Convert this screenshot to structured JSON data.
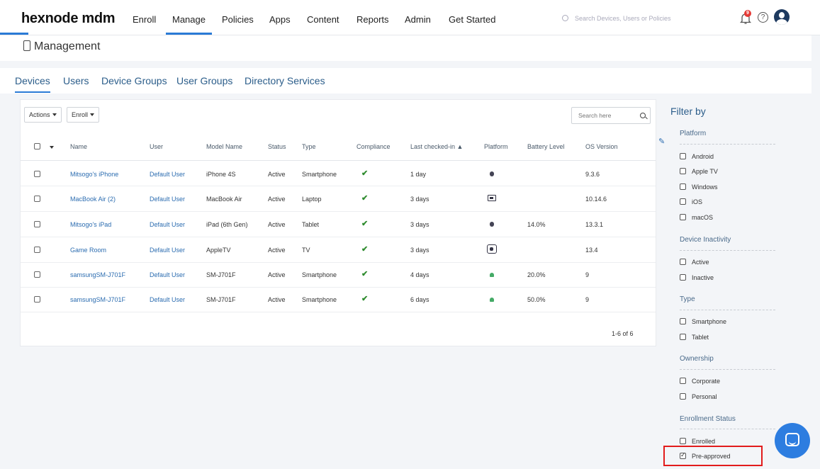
{
  "brand": "hexnode mdm",
  "nav": [
    "Enroll",
    "Manage",
    "Policies",
    "Apps",
    "Content",
    "Reports",
    "Admin",
    "Get Started"
  ],
  "nav_active": "Manage",
  "top_search_placeholder": "Search Devices, Users or Policies",
  "notification_count": "9",
  "help_glyph": "?",
  "page_title": "Management",
  "subtabs": [
    "Devices",
    "Users",
    "Device Groups",
    "User Groups",
    "Directory Services"
  ],
  "toolbar": {
    "actions": "Actions",
    "enroll": "Enroll",
    "search_placeholder": "Search here"
  },
  "columns": [
    "Name",
    "User",
    "Model Name",
    "Status",
    "Type",
    "Compliance",
    "Last checked-in ▲",
    "Platform",
    "Battery Level",
    "OS Version"
  ],
  "rows": [
    {
      "name": "Mitsogo's iPhone",
      "user": "Default User",
      "model": "iPhone 4S",
      "status": "Active",
      "type": "Smartphone",
      "compliance": "✔",
      "checked": "1 day",
      "platform": "apple-icon",
      "battery": "",
      "os": "9.3.6"
    },
    {
      "name": "MacBook Air (2)",
      "user": "Default User",
      "model": "MacBook Air",
      "status": "Active",
      "type": "Laptop",
      "compliance": "✔",
      "checked": "3 days",
      "platform": "macbook-icon",
      "battery": "",
      "os": "10.14.6"
    },
    {
      "name": "Mitsogo's iPad",
      "user": "Default User",
      "model": "iPad (6th Gen)",
      "status": "Active",
      "type": "Tablet",
      "compliance": "✔",
      "checked": "3 days",
      "platform": "apple-icon",
      "battery": "14.0%",
      "os": "13.3.1"
    },
    {
      "name": "Game Room",
      "user": "Default User",
      "model": "AppleTV",
      "status": "Active",
      "type": "TV",
      "compliance": "✔",
      "checked": "3 days",
      "platform": "apple-tv-icon",
      "battery": "",
      "os": "13.4"
    },
    {
      "name": "samsungSM-J701F",
      "user": "Default User",
      "model": "SM-J701F",
      "status": "Active",
      "type": "Smartphone",
      "compliance": "✔",
      "checked": "4 days",
      "platform": "android-icon",
      "battery": "20.0%",
      "os": "9"
    },
    {
      "name": "samsungSM-J701F",
      "user": "Default User",
      "model": "SM-J701F",
      "status": "Active",
      "type": "Smartphone",
      "compliance": "✔",
      "checked": "6 days",
      "platform": "android-icon",
      "battery": "50.0%",
      "os": "9"
    }
  ],
  "pagination": "1-6 of 6",
  "filter": {
    "title": "Filter by",
    "groups": [
      {
        "label": "Platform",
        "options": [
          "Android",
          "Apple TV",
          "Windows",
          "iOS",
          "macOS"
        ]
      },
      {
        "label": "Device Inactivity",
        "options": [
          "Active",
          "Inactive"
        ]
      },
      {
        "label": "Type",
        "options": [
          "Smartphone",
          "Tablet"
        ]
      },
      {
        "label": "Ownership",
        "options": [
          "Corporate",
          "Personal"
        ]
      },
      {
        "label": "Enrollment Status",
        "options": [
          "Enrolled",
          "Pre-approved"
        ]
      }
    ],
    "checked": "Pre-approved"
  },
  "colors": {
    "accent": "#2b7bd6",
    "link": "#2b6cb0",
    "highlight": "#e21c1c",
    "check": "#2e8b2e"
  }
}
